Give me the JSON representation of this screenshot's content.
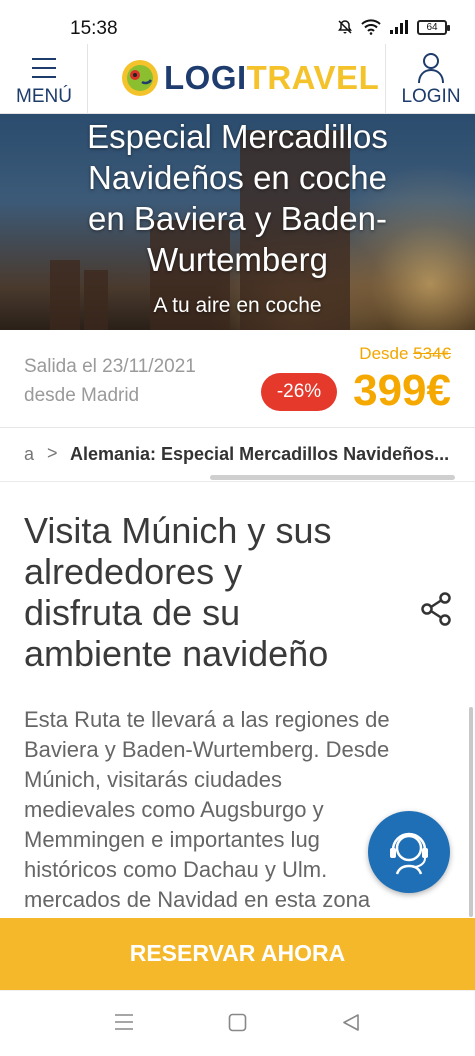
{
  "status_bar": {
    "time": "15:38",
    "battery": "64",
    "icons": [
      "bell-muted-icon",
      "wifi-icon",
      "signal-icon",
      "battery-icon"
    ]
  },
  "header": {
    "menu_label": "MENÚ",
    "logo_logi": "LOGI",
    "logo_travel": "TRAVEL",
    "login_label": "LOGIN"
  },
  "hero": {
    "title_lines": [
      "Especial Mercadillos",
      "Navideños en coche",
      "en Baviera y Baden-",
      "Wurtemberg"
    ],
    "subtitle": "A tu aire en coche"
  },
  "price": {
    "departure_line1": "Salida el 23/11/2021",
    "departure_line2": "desde Madrid",
    "desde_label": "Desde",
    "old_price": "534€",
    "discount": "-26%",
    "price": "399€"
  },
  "breadcrumb": {
    "first": "a",
    "separator": ">",
    "current": "Alemania: Especial Mercadillos Navideños..."
  },
  "content": {
    "headline_lines": [
      "Visita Múnich y sus",
      "alrededores y",
      "disfruta de su",
      "ambiente navideño"
    ],
    "body_lines": [
      "Esta Ruta te llevará a las regiones de",
      "Baviera y Baden-Wurtemberg. Desde",
      "Múnich, visitarás ciudades",
      "medievales como Augsburgo y",
      "Memmingen e importantes lug",
      "históricos como Dachau y Ulm.",
      "mercados de Navidad en esta zona"
    ]
  },
  "cta": {
    "label": "RESERVAR AHORA"
  },
  "colors": {
    "brand_navy": "#1e3d6e",
    "brand_yellow": "#f4c32b",
    "price_orange": "#f4a800",
    "discount_red": "#e5392c",
    "cta": "#f5b82a",
    "chat_blue": "#1f6fb6"
  }
}
